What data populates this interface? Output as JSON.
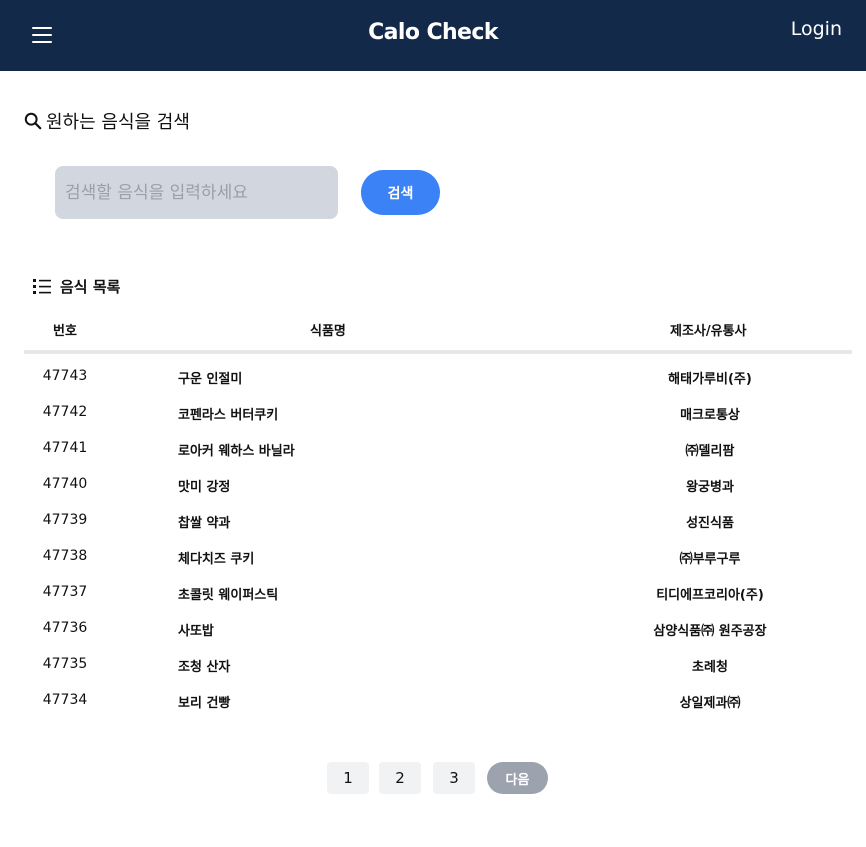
{
  "header": {
    "title": "Calo Check",
    "login_label": "Login"
  },
  "search": {
    "heading": "원하는 음식을 검색",
    "placeholder": "검색할 음식을 입력하세요",
    "value": "",
    "button_label": "검색"
  },
  "list": {
    "heading": "음식 목록",
    "columns": {
      "no": "번호",
      "name": "식품명",
      "maker": "제조사/유통사"
    },
    "rows": [
      {
        "no": "47743",
        "name": "구운 인절미",
        "maker": "해태가루비(주)"
      },
      {
        "no": "47742",
        "name": "코펜라스 버터쿠키",
        "maker": "매크로통상"
      },
      {
        "no": "47741",
        "name": "로아커 웨하스 바닐라",
        "maker": "㈜델리팜"
      },
      {
        "no": "47740",
        "name": "맛미 강정",
        "maker": "왕궁병과"
      },
      {
        "no": "47739",
        "name": "찹쌀 약과",
        "maker": "성진식품"
      },
      {
        "no": "47738",
        "name": "체다치즈 쿠키",
        "maker": "㈜부루구루"
      },
      {
        "no": "47737",
        "name": "초콜릿 웨이퍼스틱",
        "maker": "티디에프코리아(주)"
      },
      {
        "no": "47736",
        "name": "사또밥",
        "maker": "삼양식품㈜ 원주공장"
      },
      {
        "no": "47735",
        "name": "조청 산자",
        "maker": "초례청"
      },
      {
        "no": "47734",
        "name": "보리 건빵",
        "maker": "상일제과㈜"
      }
    ]
  },
  "pagination": {
    "pages": [
      "1",
      "2",
      "3"
    ],
    "next_label": "다음"
  },
  "icons": {
    "menu": "hamburger-icon",
    "search": "search-icon",
    "list": "list-icon"
  },
  "colors": {
    "header_bg": "#12294a",
    "primary": "#3b82f6",
    "input_bg": "#d2d6de",
    "next_bg": "#9ca3af"
  }
}
